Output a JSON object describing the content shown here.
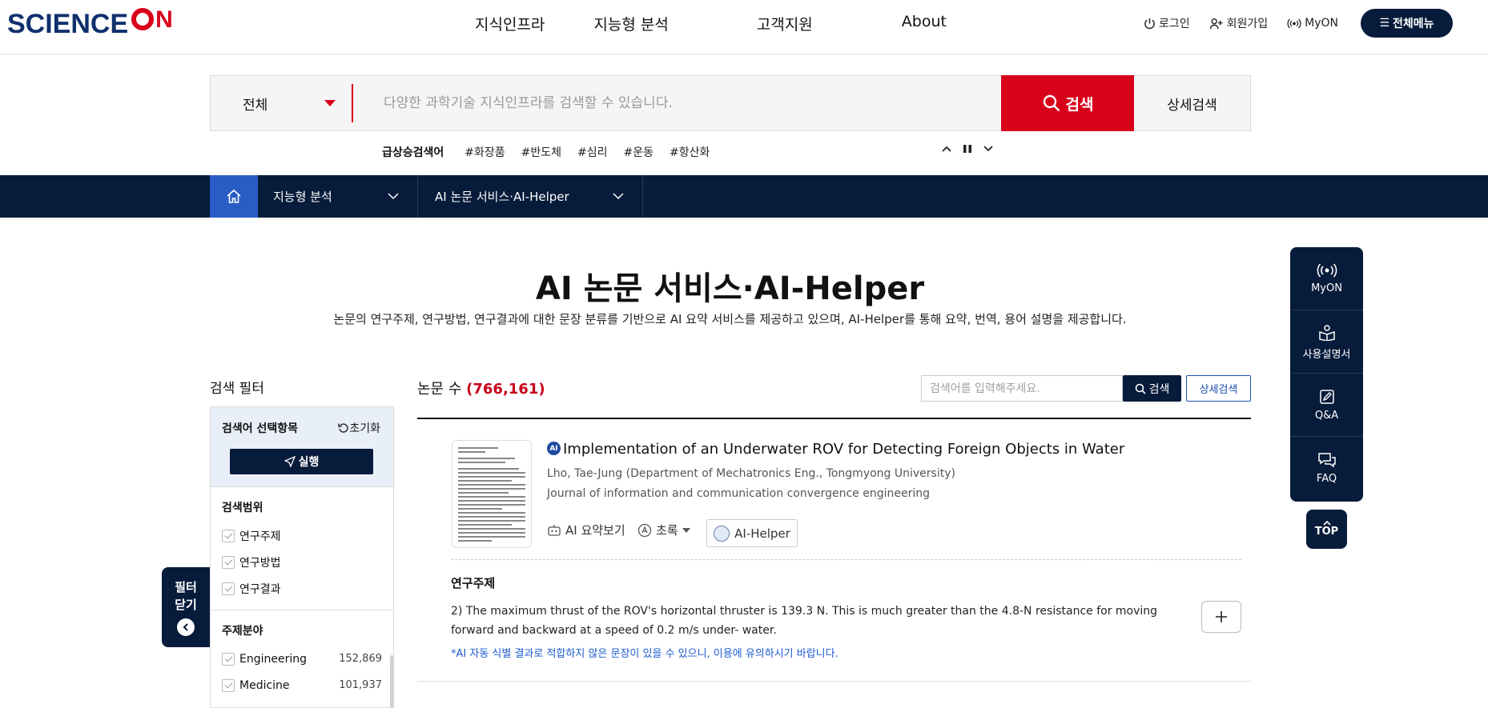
{
  "header": {
    "logo_text": "SCIENCE",
    "logo_on": "N",
    "nav": [
      "지식인프라",
      "지능형 분석",
      "고객지원",
      "About"
    ],
    "util": {
      "login": "로그인",
      "signup": "회원가입",
      "myon": "MyON"
    },
    "all_menu": "전체메뉴"
  },
  "search": {
    "category": "전체",
    "placeholder": "다양한 과학기술 지식인프라를 검색할 수 있습니다.",
    "button": "검색",
    "advanced": "상세검색"
  },
  "trending": {
    "label": "급상승검색어",
    "tags": [
      "#화장품",
      "#반도체",
      "#심리",
      "#운동",
      "#항산화"
    ]
  },
  "breadcrumb": {
    "level1": "지능형 분석",
    "level2": "AI 논문 서비스·AI-Helper"
  },
  "page": {
    "title": "AI 논문 서비스·AI-Helper",
    "description": "논문의 연구주제, 연구방법, 연구결과에 대한 문장 분류를 기반으로 AI 요약 서비스를 제공하고 있으며, AI-Helper를 통해 요약, 번역, 용어 설명을 제공합니다."
  },
  "filter": {
    "title": "검색 필터",
    "header": "검색어 선택항목",
    "reset": "초기화",
    "run": "실행",
    "scope_title": "검색범위",
    "scope": [
      "연구주제",
      "연구방법",
      "연구결과"
    ],
    "field_title": "주제분야",
    "fields": [
      {
        "name": "Engineering",
        "count": "152,869"
      },
      {
        "name": "Medicine",
        "count": "101,937"
      }
    ],
    "close": [
      "필터",
      "닫기"
    ]
  },
  "results": {
    "count_label": "논문 수",
    "count": "(766,161)",
    "search_placeholder": "검색어를 입력해주세요.",
    "search_button": "검색",
    "advanced": "상세검색",
    "items": [
      {
        "badge": "AI",
        "title": "Implementation of an Underwater ROV for Detecting Foreign Objects in Water",
        "authors": "Lho, Tae-Jung (Department of Mechatronics Eng., Tongmyong University)",
        "journal": "Journal of information and communication convergence engineering",
        "actions": {
          "summary": "AI 요약보기",
          "abstract": "초록",
          "helper": "AI-Helper"
        },
        "topic_label": "연구주제",
        "topic_text": "2) The maximum thrust of the ROV's horizontal thruster is 139.3 N. This is much greater than the 4.8-N resistance for moving forward and backward at a speed of 0.2 m/s under- water.",
        "note": "*AI 자동 식별 결과로 적합하지 않은 문장이 있을 수 있으니, 이용에 유의하시기 바랍니다."
      }
    ]
  },
  "quick_menu": [
    "MyON",
    "사용설명서",
    "Q&A",
    "FAQ"
  ],
  "top_button": "TOP",
  "colors": {
    "navy": "#071b3a",
    "red": "#d9001b",
    "blue": "#2a5cc6"
  }
}
